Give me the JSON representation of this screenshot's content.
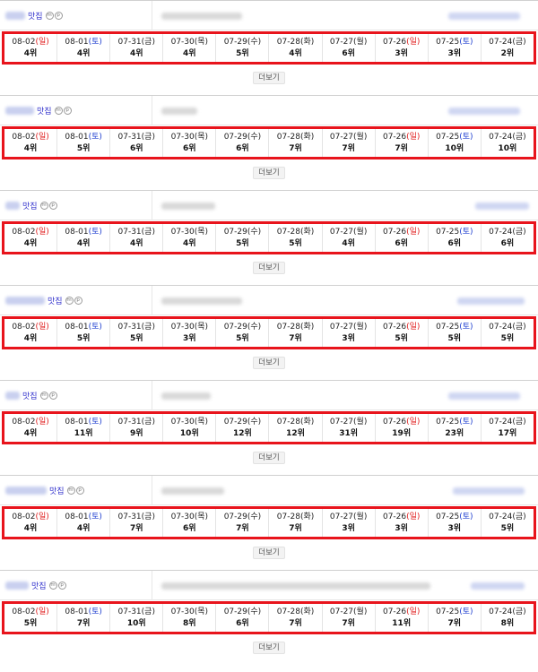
{
  "store_suffix": "맛집",
  "more_label": "더보기",
  "badges": [
    "m",
    "p"
  ],
  "dates": [
    {
      "date": "08-02",
      "dow": "일",
      "kind": "sun"
    },
    {
      "date": "08-01",
      "dow": "토",
      "kind": "sat"
    },
    {
      "date": "07-31",
      "dow": "금",
      "kind": "wk"
    },
    {
      "date": "07-30",
      "dow": "목",
      "kind": "wk"
    },
    {
      "date": "07-29",
      "dow": "수",
      "kind": "wk"
    },
    {
      "date": "07-28",
      "dow": "화",
      "kind": "wk"
    },
    {
      "date": "07-27",
      "dow": "월",
      "kind": "wk"
    },
    {
      "date": "07-26",
      "dow": "일",
      "kind": "sun"
    },
    {
      "date": "07-25",
      "dow": "토",
      "kind": "sat"
    },
    {
      "date": "07-24",
      "dow": "금",
      "kind": "wk"
    }
  ],
  "entries": [
    {
      "ranks": [
        "4위",
        "4위",
        "4위",
        "4위",
        "5위",
        "4위",
        "6위",
        "3위",
        "3위",
        "2위"
      ]
    },
    {
      "ranks": [
        "4위",
        "5위",
        "6위",
        "6위",
        "6위",
        "7위",
        "7위",
        "7위",
        "10위",
        "10위"
      ]
    },
    {
      "ranks": [
        "4위",
        "4위",
        "4위",
        "4위",
        "5위",
        "5위",
        "4위",
        "6위",
        "6위",
        "6위"
      ]
    },
    {
      "ranks": [
        "4위",
        "5위",
        "5위",
        "3위",
        "5위",
        "7위",
        "3위",
        "5위",
        "5위",
        "5위"
      ]
    },
    {
      "ranks": [
        "4위",
        "11위",
        "9위",
        "10위",
        "12위",
        "12위",
        "31위",
        "19위",
        "23위",
        "17위"
      ]
    },
    {
      "ranks": [
        "4위",
        "4위",
        "7위",
        "6위",
        "7위",
        "7위",
        "3위",
        "3위",
        "3위",
        "5위"
      ]
    },
    {
      "ranks": [
        "5위",
        "7위",
        "10위",
        "8위",
        "6위",
        "7위",
        "7위",
        "11위",
        "7위",
        "8위"
      ]
    }
  ],
  "colors": {
    "highlight_border": "#e8141c",
    "sunday": "#e02020",
    "saturday": "#2040d0",
    "name_link": "#3030cc"
  }
}
